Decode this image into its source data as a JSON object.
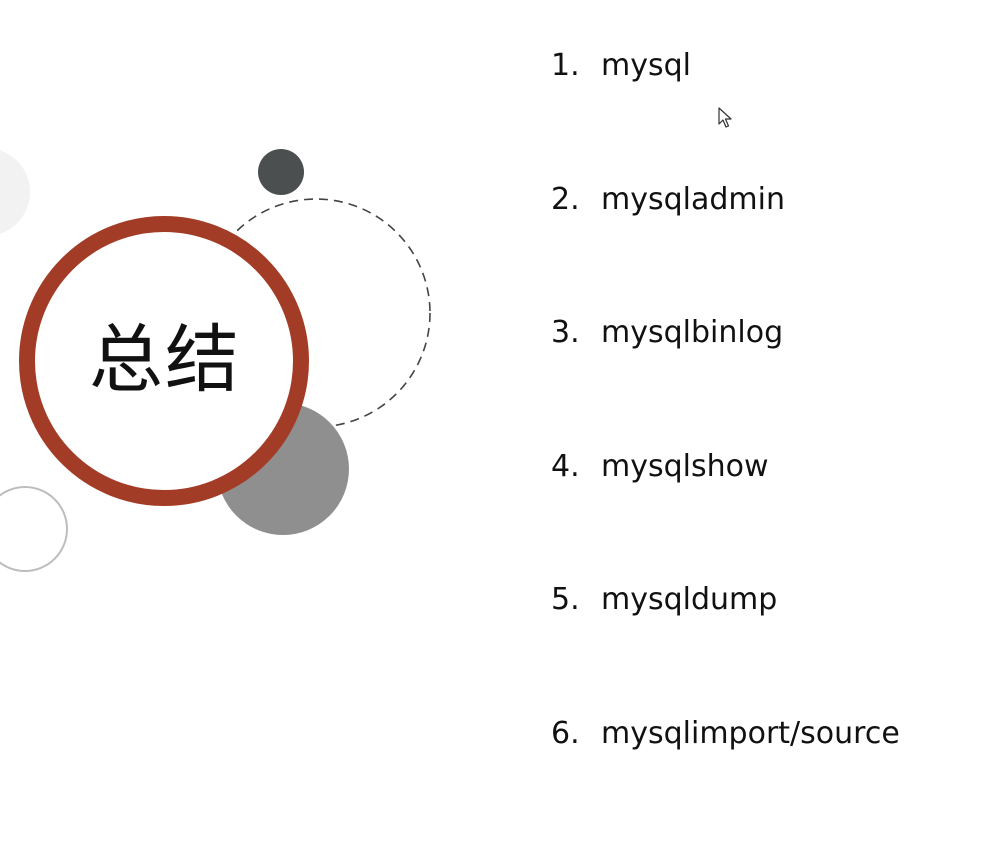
{
  "slide": {
    "title": "总结",
    "items": [
      {
        "number": "1.",
        "label": "mysql"
      },
      {
        "number": "2.",
        "label": "mysqladmin"
      },
      {
        "number": "3.",
        "label": "mysqlbinlog"
      },
      {
        "number": "4.",
        "label": "mysqlshow"
      },
      {
        "number": "5.",
        "label": "mysqldump"
      },
      {
        "number": "6.",
        "label": "mysqlimport/source"
      }
    ]
  },
  "colors": {
    "ring": "#a33c26",
    "dark_dot": "#4c4f50",
    "gray_disc": "#8f8f8f",
    "dashed_outline": "#444444",
    "light_outline": "#bdbdbd",
    "faint_disc": "#f2f2f2"
  },
  "icons": {
    "cursor": "arrow-pointer-icon"
  }
}
